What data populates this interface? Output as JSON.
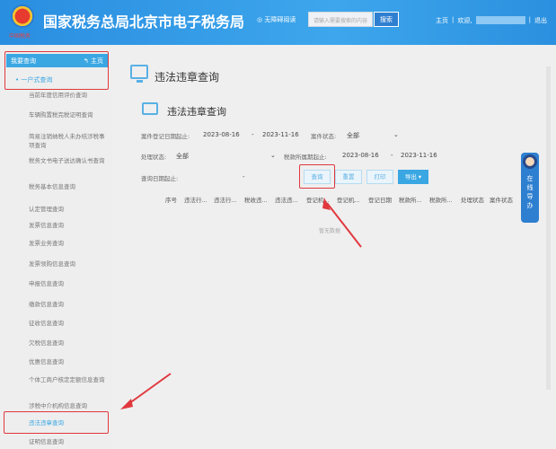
{
  "header": {
    "emblem_text": "中国税务",
    "title": "国家税务总局北京市电子税务局",
    "accessibility": "无障碍阅读",
    "search_placeholder": "请输入需要搜索的内容",
    "search_button": "搜索",
    "home": "主页",
    "welcome": "欢迎,",
    "logout": "退出",
    "sep": "|"
  },
  "sidebar": {
    "head": "我要查询",
    "home": "主页",
    "group": "一户式查询",
    "items": [
      "当前年度信用评价查询",
      "车辆购置税完税证明查询",
      "简易注销纳税人未办结涉税事项查询",
      "税务文书电子送达确认书查询",
      "税务基本信息查询",
      "认定管理查询",
      "发票信息查询",
      "发票业务查询",
      "发票领购信息查询",
      "申报信息查询",
      "缴款信息查询",
      "征收信息查询",
      "欠税信息查询",
      "优惠信息查询",
      "个体工商户核定定额信息查询",
      "涉税中介机构信息查询",
      "违法违章查询",
      "证明信息查询"
    ]
  },
  "main": {
    "page_title": "违法违章查询",
    "sub_title": "违法违章查询",
    "form": {
      "case_date_label": "案件登记日期起止:",
      "case_date_from": "2023-08-16",
      "dash": "-",
      "case_date_to": "2023-11-16",
      "case_status_label": "案件状态:",
      "case_status": "全部",
      "handle_status_label": "处理状态:",
      "handle_status": "全部",
      "tax_period_label": "税款所属期起止:",
      "tax_period_from": "2023-08-16",
      "tax_period_to": "2023-11-16",
      "query_date_label": "查询日期起止:"
    },
    "buttons": {
      "query": "查询",
      "reset": "重置",
      "print": "打印",
      "export": "导出"
    },
    "columns": [
      "序号",
      "违法行...",
      "违法行...",
      "税收违...",
      "违法违...",
      "登记机...",
      "登记机...",
      "登记日期",
      "税款所...",
      "税款所...",
      "处理状态",
      "案件状态"
    ],
    "empty": "暂无数据"
  },
  "guide": {
    "label": "在线导办"
  }
}
